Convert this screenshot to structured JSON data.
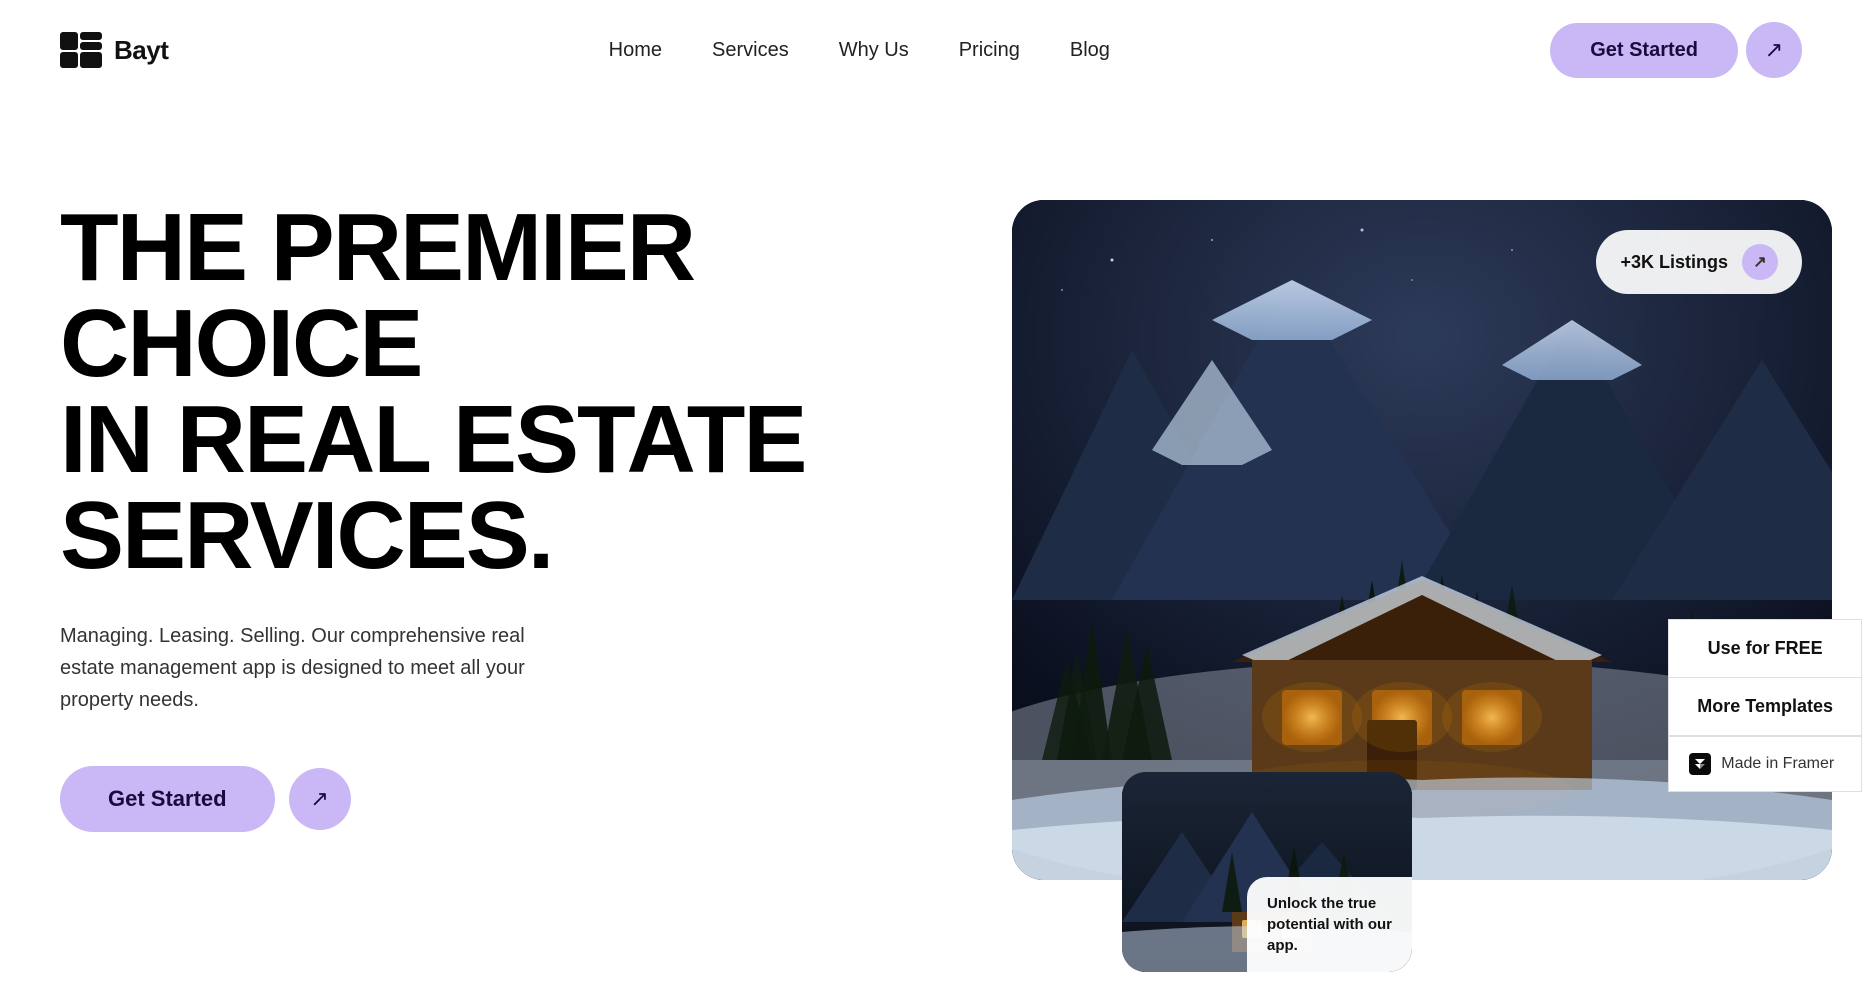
{
  "logo": {
    "name": "Bayt",
    "icon": "layout-icon"
  },
  "nav": {
    "links": [
      {
        "label": "Home",
        "id": "home"
      },
      {
        "label": "Services",
        "id": "services"
      },
      {
        "label": "Why Us",
        "id": "why-us"
      },
      {
        "label": "Pricing",
        "id": "pricing"
      },
      {
        "label": "Blog",
        "id": "blog"
      }
    ],
    "cta_label": "Get Started",
    "cta_arrow": "↗"
  },
  "hero": {
    "headline_line1": "THE PREMIER CHOICE",
    "headline_line2": "IN REAL ESTATE",
    "headline_line3": "SERVICES.",
    "subtext": "Managing. Leasing. Selling. Our comprehensive real estate management app is designed to meet all your property needs.",
    "cta_label": "Get Started",
    "cta_arrow": "↗"
  },
  "image_card": {
    "listings_badge": "+3K Listings",
    "listings_arrow": "↗"
  },
  "small_card": {
    "text_line1": "Unlock the true",
    "text_line2": "potential with our",
    "text_line3": "app."
  },
  "side_panel": {
    "use_free_label": "Use for FREE",
    "more_templates_label": "More Templates",
    "framer_label": "Made in Framer"
  }
}
